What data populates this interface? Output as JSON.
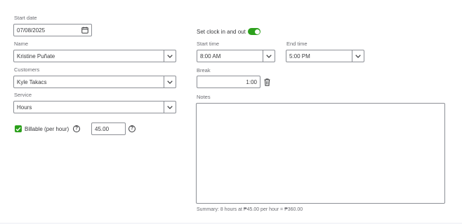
{
  "left": {
    "start_date": {
      "label": "Start date",
      "value": "07/08/2025"
    },
    "name": {
      "label": "Name",
      "value": "Kristine Puñate"
    },
    "customers": {
      "label": "Customers",
      "value": "Kyle Takacs"
    },
    "service": {
      "label": "Service",
      "value": "Hours"
    },
    "billable": {
      "label": "Billable (per hour)",
      "checked": true,
      "rate": "45.00"
    }
  },
  "right": {
    "clock_toggle": {
      "label": "Set clock in and out",
      "on": true
    },
    "start_time": {
      "label": "Start time",
      "value": "8:00 AM"
    },
    "end_time": {
      "label": "End time",
      "value": "5:00 PM"
    },
    "break": {
      "label": "Break",
      "value": "1:00"
    },
    "notes": {
      "label": "Notes",
      "value": ""
    },
    "summary": "Summary: 8 hours at ₱45.00 per hour = ₱360.00"
  },
  "icons": {
    "calendar": "calendar-icon",
    "dropdown": "chevron-down-icon",
    "delete": "trash-icon",
    "help": "help-icon",
    "check": "checkmark-icon"
  },
  "colors": {
    "accent_green": "#2ca01c",
    "border": "#8d9096",
    "label": "#6b6c72",
    "text": "#393a3d"
  }
}
